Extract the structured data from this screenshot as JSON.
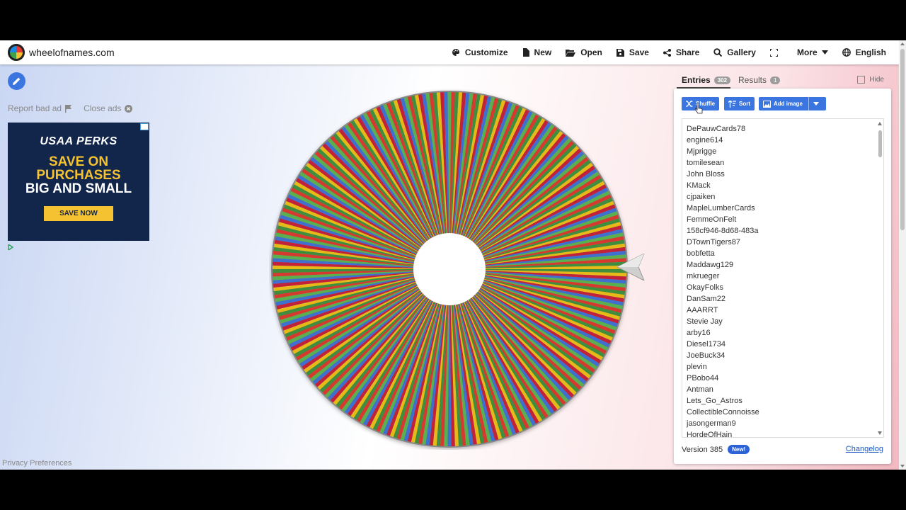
{
  "header": {
    "site_title": "wheelofnames.com",
    "nav": [
      {
        "label": "Customize",
        "icon": "palette-icon"
      },
      {
        "label": "New",
        "icon": "file-icon"
      },
      {
        "label": "Open",
        "icon": "folder-open-icon"
      },
      {
        "label": "Save",
        "icon": "floppy-icon"
      },
      {
        "label": "Share",
        "icon": "share-icon"
      },
      {
        "label": "Gallery",
        "icon": "search-icon"
      },
      {
        "label": "",
        "icon": "fullscreen-icon"
      },
      {
        "label": "More",
        "icon": "caret-down-icon"
      },
      {
        "label": "English",
        "icon": "globe-icon"
      }
    ]
  },
  "ads": {
    "report_label": "Report bad ad",
    "close_label": "Close ads",
    "banner": {
      "brand": "USAA PERKS",
      "line1": "SAVE ON",
      "line2": "PURCHASES",
      "line3": "BIG AND SMALL",
      "cta": "SAVE NOW"
    }
  },
  "footer": {
    "privacy": "Privacy Preferences"
  },
  "wheel": {
    "colors": [
      "#3e8e3e",
      "#e6b818",
      "#c2213a",
      "#3f6fcf",
      "#5ab04e",
      "#d63a2f"
    ]
  },
  "panel": {
    "tabs": {
      "entries_label": "Entries",
      "entries_count": "302",
      "results_label": "Results",
      "results_count": "1"
    },
    "hide_label": "Hide",
    "buttons": {
      "shuffle": "Shuffle",
      "sort": "Sort",
      "add_image": "Add image"
    },
    "entries": [
      "DePauwCards78",
      "engine614",
      "Mjprigge",
      "tomilesean",
      "John Bloss",
      "KMack",
      "cjpaiken",
      "MapleLumberCards",
      "FemmeOnFelt",
      "158cf946-8d68-483a",
      "DTownTigers87",
      "bobfetta",
      "Maddawg129",
      "mkrueger",
      "OkayFolks",
      "DanSam22",
      "AAARRT",
      "Stevie Jay",
      "arby16",
      "Diesel1734",
      "JoeBuck34",
      "plevin",
      "PBobo44",
      "Antman",
      "Lets_Go_Astros",
      "CollectibleConnoisse",
      "jasongerman9",
      "HordeOfHain"
    ],
    "version_label": "Version 385",
    "new_badge": "New!",
    "changelog_label": "Changelog"
  }
}
